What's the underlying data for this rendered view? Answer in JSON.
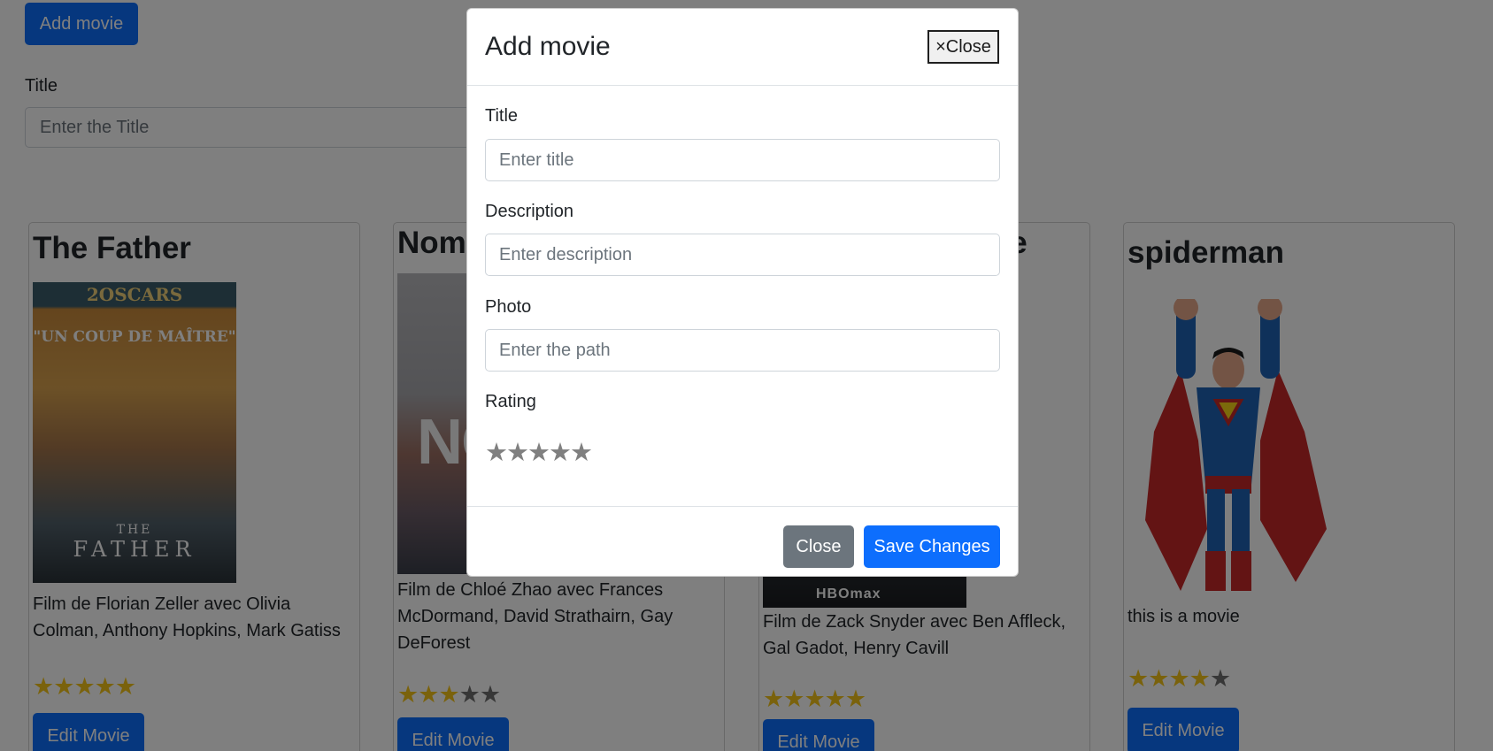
{
  "page": {
    "add_movie_label": "Add movie",
    "filter_label": "Title",
    "filter_placeholder": "Enter the Title"
  },
  "movies": [
    {
      "title": "The Father",
      "poster_lines": [
        "2OSCARS",
        "\"UN COUP DE MAÎTRE\"",
        "THE",
        "FATHER"
      ],
      "description": "Film de Florian Zeller avec Olivia Colman, Anthony Hopkins, Mark Gatiss",
      "rating": 5,
      "edit_label": "Edit Movie"
    },
    {
      "title": "Noma",
      "poster_lines": [
        "NOM"
      ],
      "description": "Film de Chloé Zhao avec Frances McDormand, David Strathairn, Gay DeForest",
      "rating": 3,
      "edit_label": "Edit Movie"
    },
    {
      "title": "ice",
      "poster_lines": [
        "HBOmax"
      ],
      "description": "Film de Zack Snyder avec Ben Affleck, Gal Gadot, Henry Cavill",
      "rating": 5,
      "edit_label": "Edit Movie"
    },
    {
      "title": "spiderman",
      "description": "this is a movie",
      "rating": 4,
      "edit_label": "Edit Movie"
    }
  ],
  "modal": {
    "title": "Add movie",
    "header_close_label": "×Close",
    "fields": {
      "title_label": "Title",
      "title_placeholder": "Enter title",
      "description_label": "Description",
      "description_placeholder": "Enter description",
      "photo_label": "Photo",
      "photo_placeholder": "Enter the path",
      "rating_label": "Rating"
    },
    "rating_value": 0,
    "rating_max": 5,
    "close_label": "Close",
    "save_label": "Save Changes"
  },
  "colors": {
    "primary": "#0d6efd",
    "secondary": "#6c757d",
    "star_filled": "#f5c518",
    "star_empty": "#6e6e6e"
  }
}
